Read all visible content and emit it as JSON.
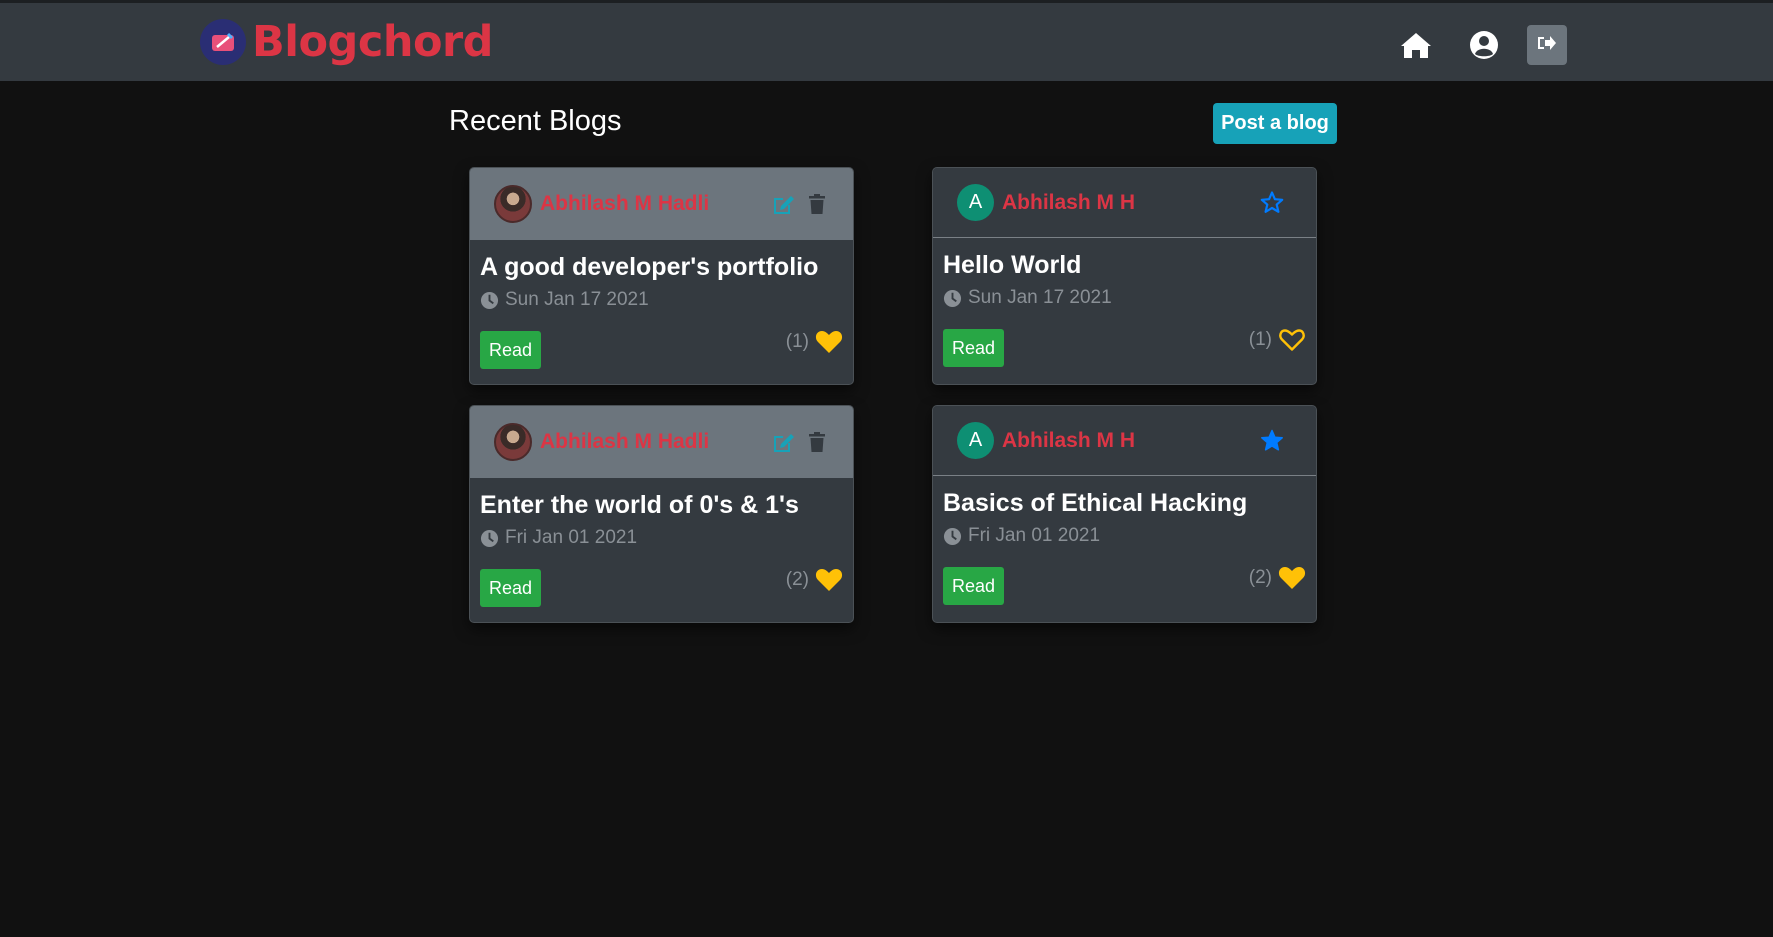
{
  "app": {
    "brand": "Blogchord"
  },
  "nav": {
    "home_icon": "home-icon",
    "profile_icon": "user-circle-icon",
    "logout_icon": "sign-out-icon"
  },
  "main": {
    "title": "Recent Blogs",
    "post_button": "Post a blog"
  },
  "colors": {
    "accent_red": "#dc3545",
    "info_teal": "#17a2b8",
    "success_green": "#28a745",
    "heart_gold": "#ffc107",
    "star_blue": "#007bff"
  },
  "blogs": [
    {
      "author": "Abhilash M Hadli",
      "title": "A good developer's portfolio",
      "date": "Sun Jan 17 2021",
      "read": "Read",
      "likes": "(1)",
      "liked": true
    },
    {
      "author": "Abhilash M H",
      "avatar_letter": "A",
      "title": "Hello World",
      "date": "Sun Jan 17 2021",
      "read": "Read",
      "likes": "(1)",
      "liked": false,
      "starred": false
    },
    {
      "author": "Abhilash M Hadli",
      "title": "Enter the world of 0's & 1's",
      "date": "Fri Jan 01 2021",
      "read": "Read",
      "likes": "(2)",
      "liked": true
    },
    {
      "author": "Abhilash M H",
      "avatar_letter": "A",
      "title": "Basics of Ethical Hacking",
      "date": "Fri Jan 01 2021",
      "read": "Read",
      "likes": "(2)",
      "liked": true,
      "starred": true
    }
  ]
}
